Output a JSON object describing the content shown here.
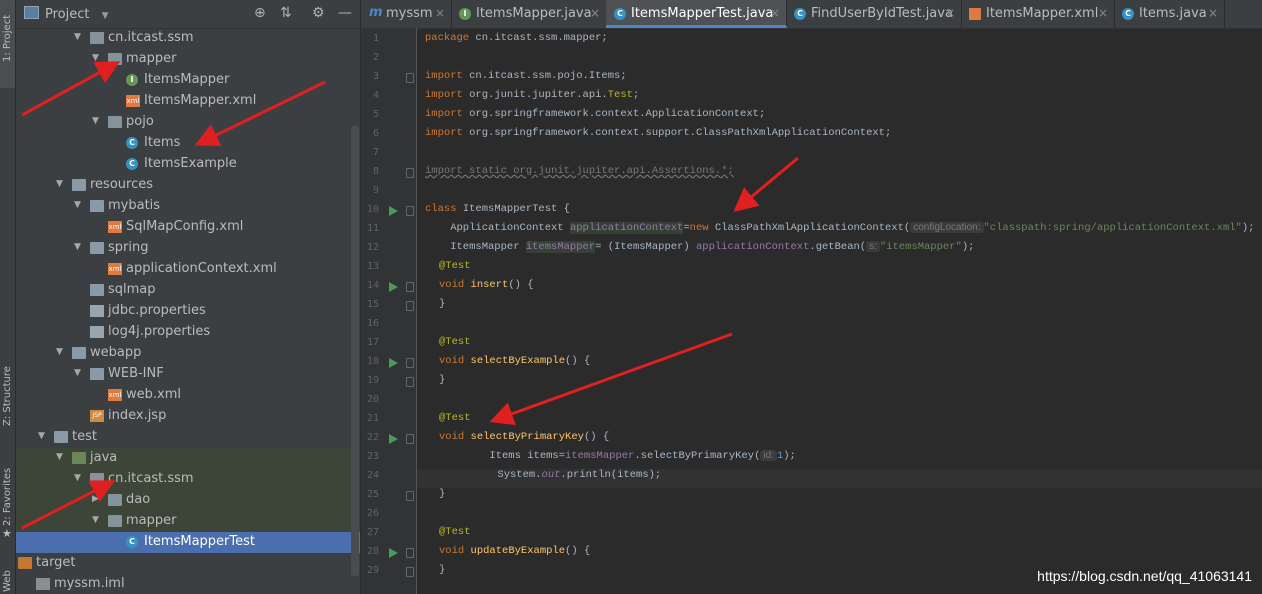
{
  "sidebar_tabs": {
    "project": "1: Project",
    "structure": "Z: Structure",
    "favorites": "2: Favorites",
    "web": "Web"
  },
  "project_panel": {
    "title": "Project",
    "tree": [
      {
        "label": "cn.itcast.ssm",
        "icon": "package-folder-icon",
        "expanded": true
      },
      {
        "label": "mapper",
        "icon": "package-folder-icon",
        "expanded": true
      },
      {
        "label": "ItemsMapper",
        "icon": "interface-icon"
      },
      {
        "label": "ItemsMapper.xml",
        "icon": "xml-file-icon"
      },
      {
        "label": "pojo",
        "icon": "package-folder-icon",
        "expanded": true
      },
      {
        "label": "Items",
        "icon": "class-icon"
      },
      {
        "label": "ItemsExample",
        "icon": "class-icon"
      },
      {
        "label": "resources",
        "icon": "resources-folder-icon",
        "expanded": true
      },
      {
        "label": "mybatis",
        "icon": "folder-icon",
        "expanded": true
      },
      {
        "label": "SqlMapConfig.xml",
        "icon": "xml-file-icon"
      },
      {
        "label": "spring",
        "icon": "folder-icon",
        "expanded": true
      },
      {
        "label": "applicationContext.xml",
        "icon": "xml-file-icon"
      },
      {
        "label": "sqlmap",
        "icon": "folder-icon"
      },
      {
        "label": "jdbc.properties",
        "icon": "properties-file-icon"
      },
      {
        "label": "log4j.properties",
        "icon": "properties-file-icon"
      },
      {
        "label": "webapp",
        "icon": "folder-icon",
        "expanded": true
      },
      {
        "label": "WEB-INF",
        "icon": "folder-icon",
        "expanded": true
      },
      {
        "label": "web.xml",
        "icon": "xml-file-icon"
      },
      {
        "label": "index.jsp",
        "icon": "jsp-file-icon"
      },
      {
        "label": "test",
        "icon": "folder-icon",
        "expanded": true
      },
      {
        "label": "java",
        "icon": "test-source-folder-icon",
        "expanded": true
      },
      {
        "label": "cn.itcast.ssm",
        "icon": "package-folder-icon",
        "expanded": true
      },
      {
        "label": "dao",
        "icon": "package-folder-icon",
        "expanded": false
      },
      {
        "label": "mapper",
        "icon": "package-folder-icon",
        "expanded": true
      },
      {
        "label": "ItemsMapperTest",
        "icon": "class-icon",
        "selected": true
      },
      {
        "label": "target",
        "icon": "excluded-folder-icon",
        "expanded": false
      },
      {
        "label": "myssm.iml",
        "icon": "iml-file-icon"
      }
    ]
  },
  "editor_tabs": [
    {
      "label": "myssm",
      "icon": "module-icon"
    },
    {
      "label": "ItemsMapper.java",
      "icon": "interface-icon"
    },
    {
      "label": "ItemsMapperTest.java",
      "icon": "class-icon",
      "active": true
    },
    {
      "label": "FindUserByIdTest.java",
      "icon": "class-icon"
    },
    {
      "label": "ItemsMapper.xml",
      "icon": "xml-file-icon"
    },
    {
      "label": "Items.java",
      "icon": "class-icon"
    }
  ],
  "code": {
    "line_numbers": [
      "1",
      "2",
      "3",
      "4",
      "5",
      "6",
      "7",
      "8",
      "9",
      "10",
      "11",
      "12",
      "13",
      "14",
      "15",
      "16",
      "17",
      "18",
      "19",
      "20",
      "21",
      "22",
      "23",
      "24",
      "25",
      "26",
      "27",
      "28",
      "29"
    ],
    "l1_kw": "package",
    "l1_rest": " cn.itcast.ssm.mapper;",
    "l3_kw": "import",
    "l3_rest": " cn.itcast.ssm.pojo.Items;",
    "l4_kw": "import",
    "l4_rest": " org.junit.jupiter.api.",
    "l4_test": "Test",
    "l4_end": ";",
    "l5_kw": "import",
    "l5_rest": " org.springframework.context.ApplicationContext;",
    "l6_kw": "import",
    "l6_rest": " org.springframework.context.support.ClassPathXmlApplicationContext;",
    "l8": "import static org.junit.jupiter.api.Assertions.*;",
    "l10_kw": "class",
    "l10_rest": " ItemsMapperTest {",
    "l11_a": "    ApplicationContext ",
    "l11_var": "applicationContext",
    "l11_eq": "=",
    "l11_new": "new",
    "l11_b": " ClassPathXmlApplicationContext(",
    "l11_hint": "configLocation:",
    "l11_str": "\"classpath:spring/applicationContext.xml\"",
    "l11_end": ");",
    "l12_a": "    ItemsMapper ",
    "l12_var": "itemsMapper",
    "l12_b": "= (ItemsMapper) ",
    "l12_ctx": "applicationContext",
    "l12_c": ".getBean(",
    "l12_hint": "s:",
    "l12_str": "\"itemsMapper\"",
    "l12_end": ");",
    "ann_test": "@Test",
    "void_kw": "void",
    "insert": " insert",
    "selectByExample": " selectByExample",
    "selectByPrimaryKey": " selectByPrimaryKey",
    "updateByExample": " updateByExample",
    "method_tail": "() {",
    "close_brace": "}",
    "l23_a": "        Items items=",
    "l23_var": "itemsMapper",
    "l23_b": ".selectByPrimaryKey(",
    "l23_hint": "id:",
    "l23_num": "1",
    "l23_end": ");",
    "l24_a": "        System.",
    "l24_out": "out",
    "l24_b": ".println(items);"
  },
  "watermark": "https://blog.csdn.net/qq_41063141",
  "colors": {
    "arrow": "#e02020",
    "selection": "#4b6eaf",
    "tab_underline": "#4a88c7"
  }
}
